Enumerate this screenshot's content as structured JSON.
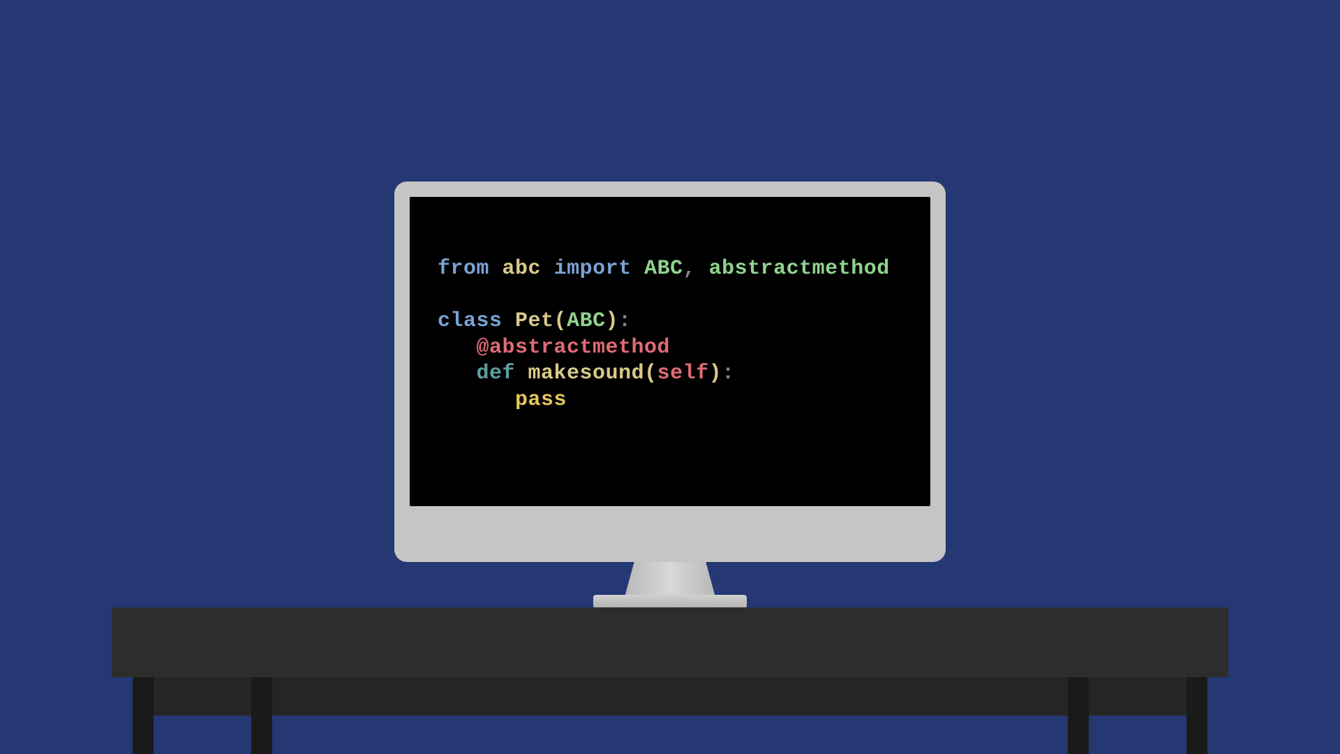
{
  "code": {
    "line1": {
      "from": "from",
      "module": "abc",
      "import": "import",
      "name1": "ABC",
      "comma": ",",
      "name2": "abstractmethod"
    },
    "line2": {
      "class_kw": "class",
      "name": "Pet",
      "lparen": "(",
      "base": "ABC",
      "rparen": ")",
      "colon": ":"
    },
    "line3": {
      "decorator": "@abstractmethod"
    },
    "line4": {
      "def_kw": "def",
      "funcname": "makesound",
      "lparen": "(",
      "self": "self",
      "rparen": ")",
      "colon": ":"
    },
    "line5": {
      "pass_kw": "pass"
    }
  },
  "colors": {
    "background": "#253873",
    "screen": "#000000",
    "monitor_bezel": "#c5c5c5",
    "desk": "#2d2d2d"
  }
}
